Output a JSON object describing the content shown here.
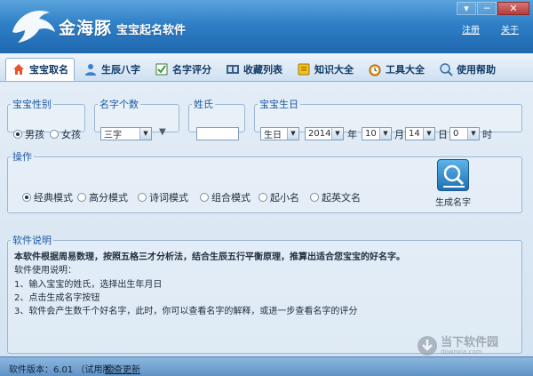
{
  "app": {
    "brand": "金海豚",
    "brand_sub": "宝宝起名软件",
    "links": {
      "register": "注册",
      "about": "关于"
    },
    "win": {
      "min": "▾",
      "max": "─",
      "close": "✕"
    }
  },
  "tabs": [
    {
      "label": "宝宝取名",
      "active": true
    },
    {
      "label": "生辰八字"
    },
    {
      "label": "名字评分"
    },
    {
      "label": "收藏列表"
    },
    {
      "label": "知识大全"
    },
    {
      "label": "工具大全"
    },
    {
      "label": "使用帮助"
    }
  ],
  "gender": {
    "legend": "宝宝性别",
    "male": "男孩",
    "female": "女孩",
    "selected": "男孩"
  },
  "name_count": {
    "legend": "名字个数",
    "value": "三字"
  },
  "surname": {
    "legend": "姓氏",
    "value": ""
  },
  "birthday": {
    "legend": "宝宝生日",
    "calendar": "生日",
    "year": "2014",
    "year_unit": "年",
    "month": "10",
    "month_unit": "月",
    "day": "14",
    "day_unit": "日",
    "hour": "0",
    "hour_unit": "时"
  },
  "operation": {
    "legend": "操作",
    "modes": [
      "经典模式",
      "高分模式",
      "诗词模式",
      "组合模式",
      "起小名",
      "起英文名"
    ],
    "selected": "经典模式",
    "generate": "生成名字"
  },
  "info": {
    "legend": "软件说明",
    "lines": [
      "本软件根据周易数理，按照五格三才分析法，结合生辰五行平衡原理，推算出适合您宝宝的好名字。",
      "软件使用说明：",
      "1、输入宝宝的姓氏，选择出生年月日",
      "2、点击生成名字按钮",
      "3、软件会产生数千个好名字，此时，你可以查看名字的解释，或进一步查看名字的评分"
    ]
  },
  "status": {
    "version": "软件版本：6.01 （试用版）",
    "update": "检查更新"
  },
  "watermark": {
    "title": "当下软件园",
    "url": "downxia.com"
  }
}
